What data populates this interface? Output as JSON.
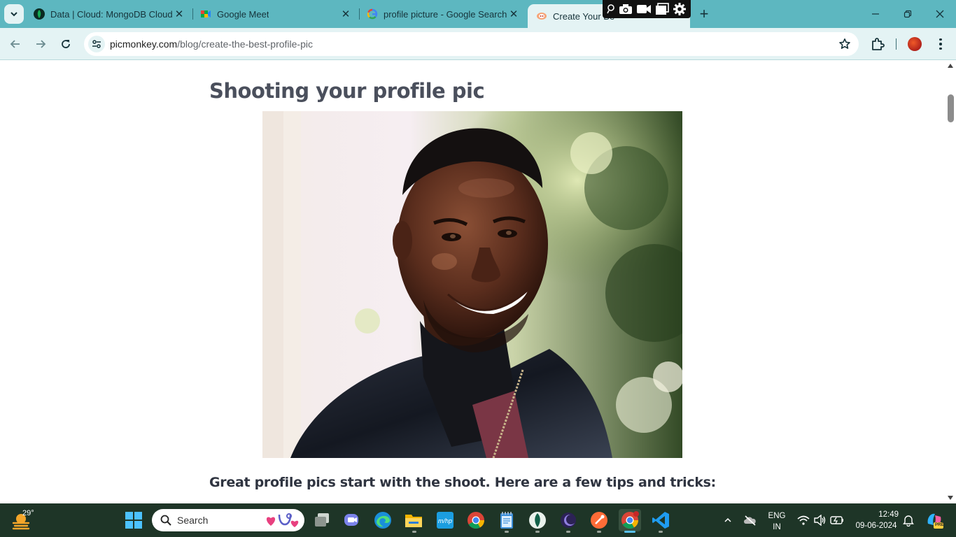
{
  "browser": {
    "tabs": [
      {
        "title": "Data | Cloud: MongoDB Cloud",
        "favicon": "mongodb-leaf-icon",
        "active": false
      },
      {
        "title": "Google Meet",
        "favicon": "google-meet-icon",
        "active": false
      },
      {
        "title": "profile picture - Google Search",
        "favicon": "google-g-icon",
        "active": false
      },
      {
        "title": "Create Your Be",
        "favicon": "picmonkey-icon",
        "active": true
      }
    ],
    "address": {
      "domain": "picmonkey.com",
      "path": "/blog/create-the-best-profile-pic"
    }
  },
  "page": {
    "heading": "Shooting your profile pic",
    "photo_alt": "smiling-man-leather-jacket",
    "lead_text": "Great profile pics start with the shoot. Here are a few tips and tricks:"
  },
  "taskbar": {
    "weather_temp": "29°",
    "search_placeholder": "Search",
    "language": "ENG",
    "region": "IN",
    "time": "12:49",
    "date": "09-06-2024",
    "copilot_badge": "PRE"
  },
  "colors": {
    "tabstrip": "#5db7c0",
    "toolbar": "#e4f3f4",
    "taskbar": "#1e3527",
    "heading": "#4a4f5c"
  }
}
